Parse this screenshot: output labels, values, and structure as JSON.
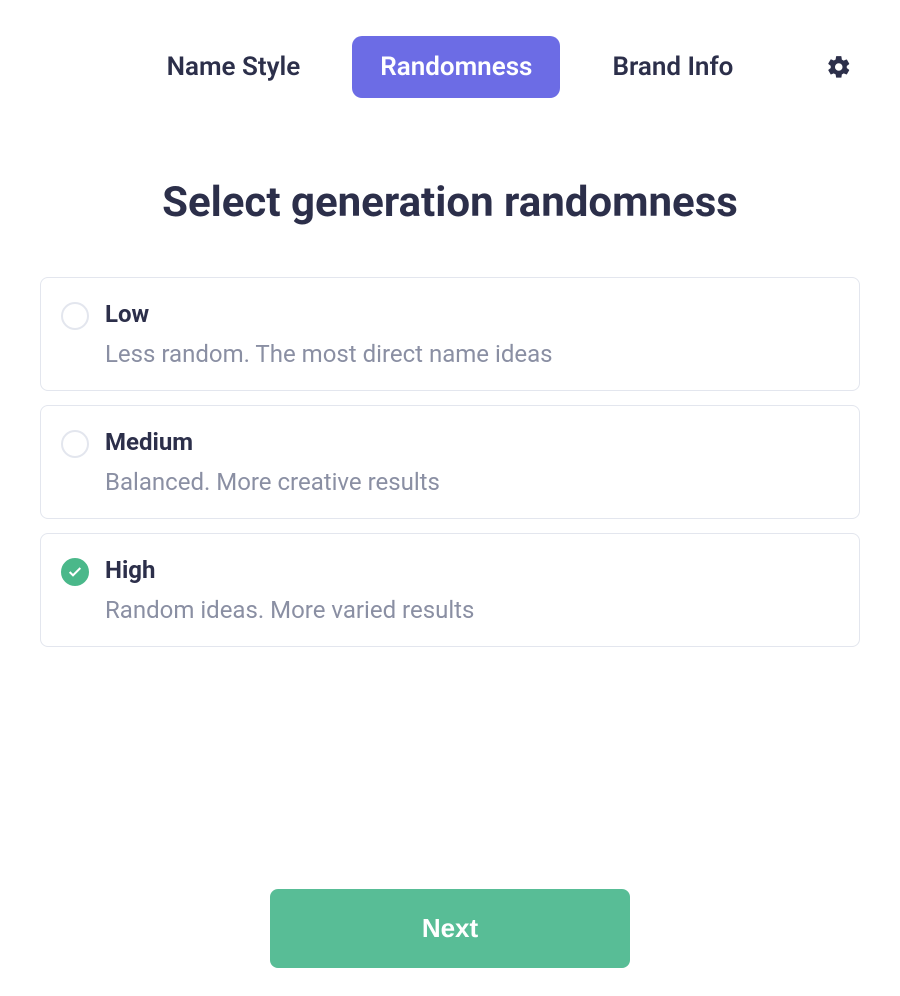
{
  "tabs": {
    "name_style": "Name Style",
    "randomness": "Randomness",
    "brand_info": "Brand Info",
    "active_index": 1
  },
  "icons": {
    "gear": "gear-icon",
    "check": "check-icon"
  },
  "heading": "Select generation randomness",
  "options": [
    {
      "title": "Low",
      "desc": "Less random. The most direct name ideas",
      "selected": false
    },
    {
      "title": "Medium",
      "desc": "Balanced. More creative results",
      "selected": false
    },
    {
      "title": "High",
      "desc": "Random ideas. More varied results",
      "selected": true
    }
  ],
  "next_label": "Next",
  "colors": {
    "accent": "#6c6ce5",
    "success": "#4ab88a",
    "text_primary": "#2c2f4a",
    "text_secondary": "#8a8fa3",
    "border": "#e3e6ee"
  }
}
